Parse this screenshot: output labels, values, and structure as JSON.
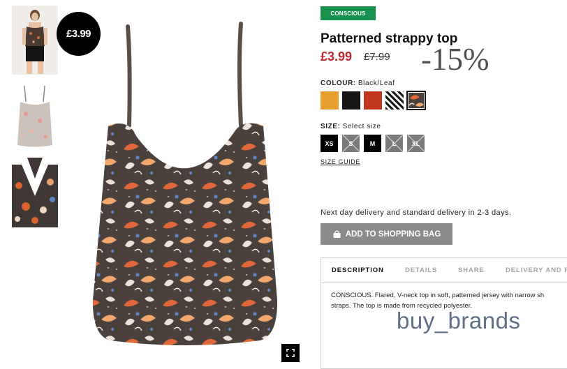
{
  "gallery": {
    "price_badge": "£3.99",
    "thumbnails": [
      {
        "name": "model-front"
      },
      {
        "name": "product-back"
      },
      {
        "name": "product-detail"
      }
    ],
    "fullscreen_icon": "fullscreen-icon"
  },
  "product": {
    "tag": "CONSCIOUS",
    "title": "Patterned strappy top",
    "price": "£3.99",
    "old_price": "£7.99",
    "discount": "-15%",
    "colour_label": "COLOUR:",
    "colour_value": "Black/Leaf",
    "colours": [
      "#e8a030",
      "#151515",
      "#c0391f",
      "pattern-bw",
      "pattern-leaf"
    ],
    "size_label": "SIZE:",
    "size_value": "Select size",
    "sizes": [
      {
        "label": "XS",
        "available": true
      },
      {
        "label": "S",
        "available": false
      },
      {
        "label": "M",
        "available": true
      },
      {
        "label": "L",
        "available": false
      },
      {
        "label": "XL",
        "available": false
      }
    ],
    "size_guide": "SIZE GUIDE",
    "delivery": "Next day delivery and standard delivery in 2-3 days.",
    "add_to_bag": "ADD TO SHOPPING BAG"
  },
  "tabs": {
    "items": [
      "DESCRIPTION",
      "DETAILS",
      "SHARE",
      "DELIVERY AND PA"
    ],
    "description_line1": "CONSCIOUS. Flared, V-neck top in soft, patterned jersey with narrow sh",
    "description_line2": "straps. The top is made from recycled polyester."
  },
  "watermark": "buy_brands",
  "colors": {
    "sale_red": "#c4262e",
    "conscious_green": "#19904e",
    "button_grey": "#8a8a8a"
  }
}
